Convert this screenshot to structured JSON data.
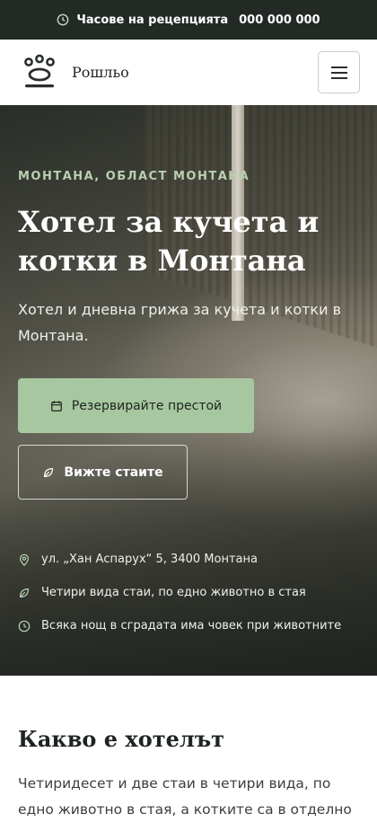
{
  "topbar": {
    "label": "Часове на рецепцията",
    "phone": "000 000 000",
    "icon": "clock-icon"
  },
  "navbar": {
    "brand": "Рошльо",
    "logo_icon": "paw-icon",
    "menu_icon": "hamburger-icon"
  },
  "hero": {
    "eyebrow": "МОНТАНА, ОБЛАСТ МОНТАНА",
    "title": "Хотел за кучета и котки в Монтана",
    "subtitle": "Хотел и дневна грижа за кучета и котки в Монтана.",
    "primary_button": "Резервирайте престой",
    "secondary_button": "Вижте стаите",
    "facts": [
      {
        "icon": "map-pin-icon",
        "text": "ул. „Хан Аспарух“ 5, 3400 Монтана"
      },
      {
        "icon": "leaf-icon",
        "text": "Четири вида стаи, по едно животно в стая"
      },
      {
        "icon": "clock-icon",
        "text": "Всяка нощ в сградата има човек при животните"
      }
    ]
  },
  "about": {
    "title": "Какво е хотелът",
    "text": "Четиридесет и две стаи в четири вида, по едно животно в стая, а котките са в отделно"
  },
  "colors": {
    "topbar_bg": "#232a25",
    "accent_green": "#a7c7a0",
    "eyebrow_green": "#b8d0b0"
  }
}
